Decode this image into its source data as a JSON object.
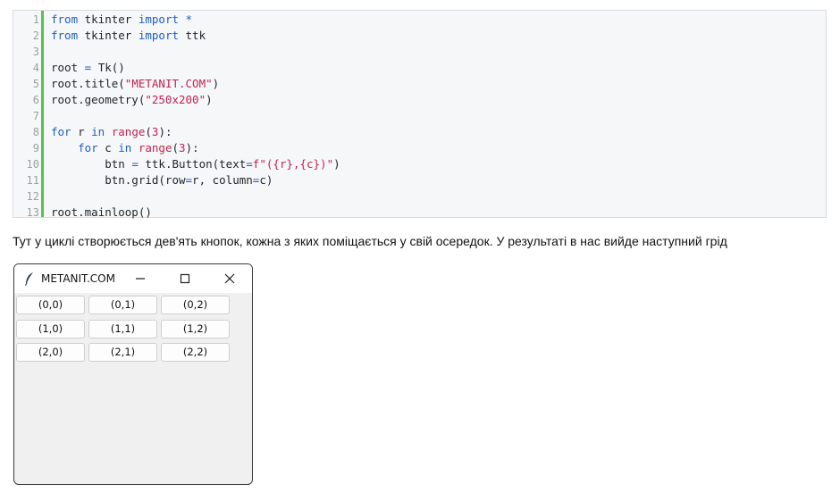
{
  "code": {
    "line_numbers": [
      "1",
      "2",
      "3",
      "4",
      "5",
      "6",
      "7",
      "8",
      "9",
      "10",
      "11",
      "12",
      "13"
    ],
    "lines": [
      [
        {
          "t": "from",
          "c": "kw"
        },
        {
          "t": " tkinter ",
          "c": ""
        },
        {
          "t": "import",
          "c": "kw"
        },
        {
          "t": " *",
          "c": "op"
        }
      ],
      [
        {
          "t": "from",
          "c": "kw"
        },
        {
          "t": " tkinter ",
          "c": ""
        },
        {
          "t": "import",
          "c": "kw"
        },
        {
          "t": " ttk",
          "c": ""
        }
      ],
      [],
      [
        {
          "t": "root ",
          "c": ""
        },
        {
          "t": "=",
          "c": "op"
        },
        {
          "t": " Tk()",
          "c": ""
        }
      ],
      [
        {
          "t": "root.title(",
          "c": ""
        },
        {
          "t": "\"METANIT.COM\"",
          "c": "str"
        },
        {
          "t": ")",
          "c": ""
        }
      ],
      [
        {
          "t": "root.geometry(",
          "c": ""
        },
        {
          "t": "\"250x200\"",
          "c": "str"
        },
        {
          "t": ")",
          "c": ""
        }
      ],
      [],
      [
        {
          "t": "for",
          "c": "kw"
        },
        {
          "t": " r ",
          "c": ""
        },
        {
          "t": "in",
          "c": "kw"
        },
        {
          "t": " ",
          "c": ""
        },
        {
          "t": "range",
          "c": "str"
        },
        {
          "t": "(",
          "c": ""
        },
        {
          "t": "3",
          "c": "num"
        },
        {
          "t": "):",
          "c": ""
        }
      ],
      [
        {
          "t": "    ",
          "c": ""
        },
        {
          "t": "for",
          "c": "kw"
        },
        {
          "t": " c ",
          "c": ""
        },
        {
          "t": "in",
          "c": "kw"
        },
        {
          "t": " ",
          "c": ""
        },
        {
          "t": "range",
          "c": "str"
        },
        {
          "t": "(",
          "c": ""
        },
        {
          "t": "3",
          "c": "num"
        },
        {
          "t": "):",
          "c": ""
        }
      ],
      [
        {
          "t": "        btn ",
          "c": ""
        },
        {
          "t": "=",
          "c": "op"
        },
        {
          "t": " ttk.Button(text",
          "c": ""
        },
        {
          "t": "=",
          "c": "op"
        },
        {
          "t": "f\"({r},{c})\"",
          "c": "str"
        },
        {
          "t": ")",
          "c": ""
        }
      ],
      [
        {
          "t": "        btn.grid(row",
          "c": ""
        },
        {
          "t": "=",
          "c": "op"
        },
        {
          "t": "r, column",
          "c": ""
        },
        {
          "t": "=",
          "c": "op"
        },
        {
          "t": "c)",
          "c": ""
        }
      ],
      [],
      [
        {
          "t": "root.mainloop()",
          "c": ""
        }
      ]
    ]
  },
  "paragraph": "Тут у циклі створюється дев'ять кнопок, кожна з яких поміщається у свій осередок. У результаті в нас вийде наступний грід",
  "window": {
    "title": "METANIT.COM",
    "buttons": [
      [
        "(0,0)",
        "(0,1)",
        "(0,2)"
      ],
      [
        "(1,0)",
        "(1,1)",
        "(1,2)"
      ],
      [
        "(2,0)",
        "(2,1)",
        "(2,2)"
      ]
    ],
    "icons": [
      "feather-icon",
      "minimize-icon",
      "maximize-icon",
      "close-icon"
    ]
  },
  "colors": {
    "accent_bar": "#58c24a",
    "keyword": "#1f5fbf",
    "string": "#c4224d"
  }
}
